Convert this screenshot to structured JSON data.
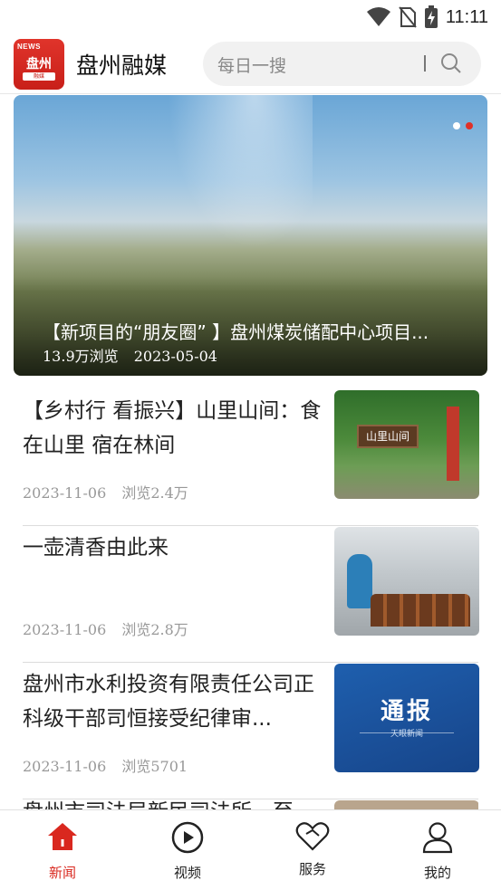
{
  "status_bar": {
    "time": "11:11",
    "icons": [
      "wifi-icon",
      "no-sim-icon",
      "battery-charging-icon"
    ]
  },
  "header": {
    "logo_text_top": "NEWS",
    "logo_text_main": "盘州",
    "logo_text_sub": "融媒",
    "app_title": "盘州融媒",
    "search_placeholder": "每日一搜"
  },
  "banner": {
    "title": "【新项目的“朋友圈” 】盘州煤炭储配中心项目...",
    "views": "13.9万浏览",
    "date": "2023-05-04",
    "dots": 2,
    "active_dot": 2
  },
  "news": [
    {
      "title": "【乡村行 看振兴】山里山间：食在山里 宿在林间",
      "date": "2023-11-06",
      "views": "浏览2.4万",
      "thumb_text": "山里山间"
    },
    {
      "title": "一壶清香由此来",
      "date": "2023-11-06",
      "views": "浏览2.8万"
    },
    {
      "title": "盘州市水利投资有限责任公司正科级干部司恒接受纪律审...",
      "date": "2023-11-06",
      "views": "浏览5701",
      "thumb_text": "通报",
      "thumb_sub": "天眼新闻"
    }
  ],
  "partial_item": {
    "title": "盘州市司法局新民司法所一至"
  },
  "tabbar": {
    "tabs": [
      {
        "label": "新闻",
        "icon": "home-icon",
        "active": true
      },
      {
        "label": "视频",
        "icon": "play-icon",
        "active": false
      },
      {
        "label": "服务",
        "icon": "heart-icon",
        "active": false
      },
      {
        "label": "我的",
        "icon": "user-icon",
        "active": false
      }
    ]
  },
  "colors": {
    "accent": "#d9281f",
    "muted": "#999999"
  }
}
